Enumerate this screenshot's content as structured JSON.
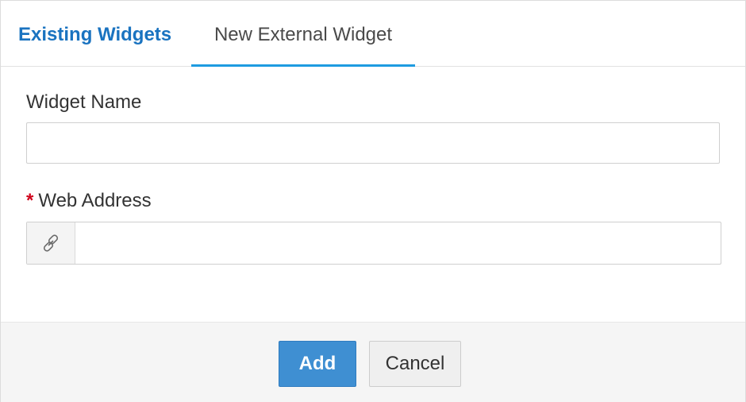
{
  "tabs": {
    "existing_label": "Existing Widgets",
    "new_label": "New External Widget",
    "active": "new"
  },
  "form": {
    "widget_name_label": "Widget Name",
    "widget_name_value": "",
    "web_address_required_mark": "*",
    "web_address_label": "Web Address",
    "web_address_value": "",
    "web_address_icon": "link-icon"
  },
  "footer": {
    "add_label": "Add",
    "cancel_label": "Cancel"
  },
  "colors": {
    "tab_link": "#1a73c0",
    "tab_active_underline": "#1e9be0",
    "required_mark": "#d0021b",
    "primary_button": "#3f8fd2",
    "footer_background": "#f5f5f5"
  }
}
